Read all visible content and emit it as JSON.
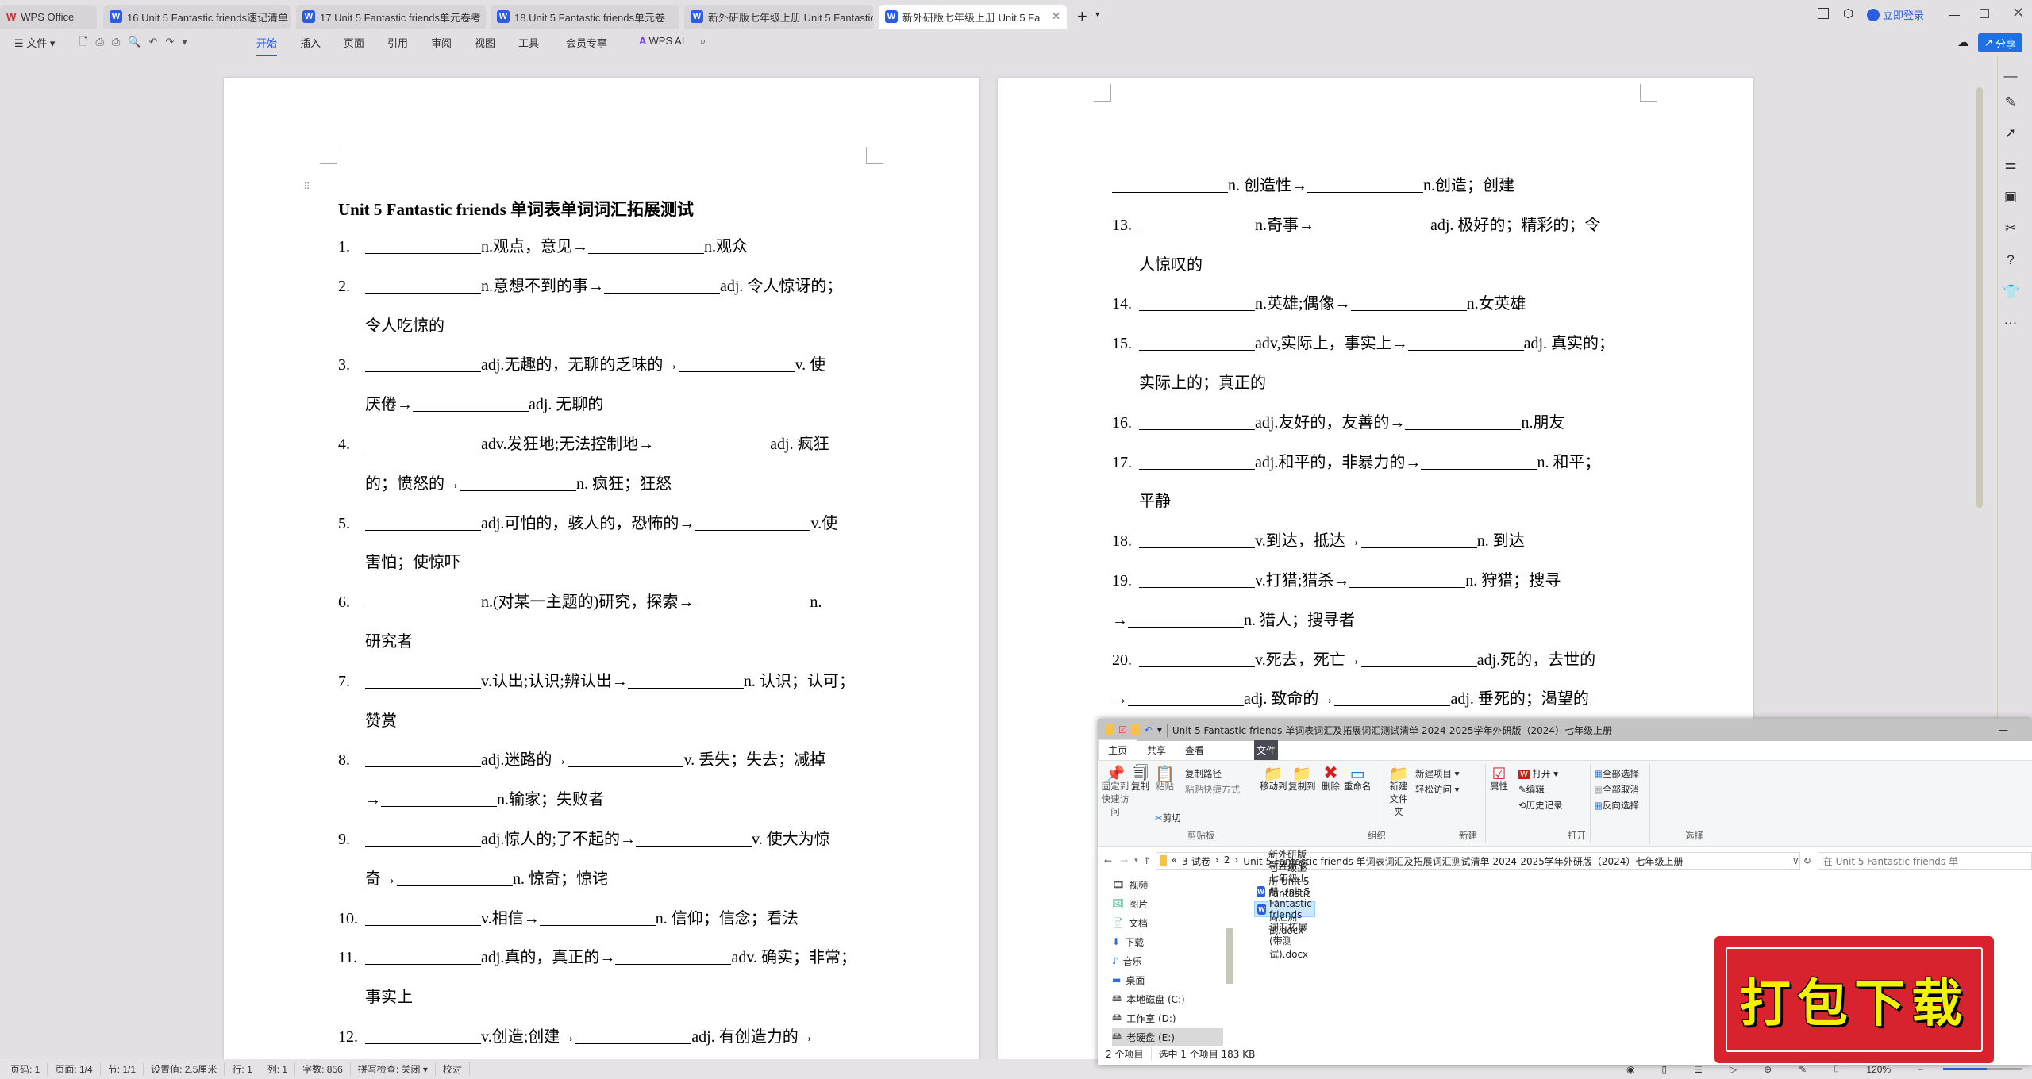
{
  "tabs": [
    {
      "label": "WPS Office",
      "icon": "wps-logo-icon"
    },
    {
      "label": "16.Unit 5 Fantastic friends速记清单"
    },
    {
      "label": "17.Unit 5 Fantastic friends单元卷考"
    },
    {
      "label": "18.Unit 5 Fantastic friends单元卷"
    },
    {
      "label": "新外研版七年级上册 Unit 5 Fantastic"
    },
    {
      "label": "新外研版七年级上册 Unit 5 Fa",
      "active": true
    }
  ],
  "titlebar": {
    "login": "立即登录",
    "share": "分享"
  },
  "toolbar": {
    "file": "文件",
    "menus": [
      "开始",
      "插入",
      "页面",
      "引用",
      "审阅",
      "视图",
      "工具",
      "会员专享"
    ],
    "active": "开始",
    "ai": "WPS AI"
  },
  "page1": {
    "title": "Unit 5 Fantastic friends  单词表单词词汇拓展测试",
    "lines": [
      {
        "num": "1.",
        "segs": [
          "",
          "n.观点，意见→",
          "",
          "n.观众"
        ]
      },
      {
        "num": "2.",
        "segs": [
          "",
          "n.意想不到的事→",
          "",
          "adj. 令人惊讶的；"
        ]
      },
      {
        "indent": true,
        "segs": [
          "令人吃惊的"
        ]
      },
      {
        "num": "3.",
        "segs": [
          "",
          "adj.无趣的，无聊的乏味的→",
          "",
          "v. 使"
        ]
      },
      {
        "indent": true,
        "segs": [
          "厌倦→",
          "",
          "adj. 无聊的"
        ]
      },
      {
        "num": "4.",
        "segs": [
          "",
          "adv.发狂地;无法控制地→",
          "",
          "adj. 疯狂"
        ]
      },
      {
        "indent": true,
        "segs": [
          "的；愤怒的→",
          "",
          "n. 疯狂；狂怒"
        ]
      },
      {
        "num": "5.",
        "segs": [
          "",
          "adj.可怕的，骇人的，恐怖的→",
          "",
          "v.使"
        ]
      },
      {
        "indent": true,
        "segs": [
          "害怕；使惊吓"
        ]
      },
      {
        "num": "6.",
        "segs": [
          "",
          "n.(对某一主题的)研究，探索→",
          "",
          "n."
        ]
      },
      {
        "indent": true,
        "segs": [
          "研究者"
        ]
      },
      {
        "num": "7.",
        "segs": [
          "",
          "v.认出;认识;辨认出→",
          "",
          "n. 认识；认可；"
        ]
      },
      {
        "indent": true,
        "segs": [
          "赞赏"
        ]
      },
      {
        "num": "8.",
        "segs": [
          "",
          "adj.迷路的→",
          "",
          "v. 丢失；失去；减掉"
        ]
      },
      {
        "indent": true,
        "segs": [
          "→",
          "",
          "n.输家；失败者"
        ]
      },
      {
        "num": "9.",
        "segs": [
          "",
          "adj.惊人的;了不起的→",
          "",
          "v. 使大为惊"
        ]
      },
      {
        "indent": true,
        "segs": [
          "奇→",
          "",
          "n. 惊奇；惊诧"
        ]
      },
      {
        "num": "10.",
        "segs": [
          "",
          "v.相信→",
          "",
          "n. 信仰；信念；看法"
        ]
      },
      {
        "num": "11.",
        "segs": [
          "",
          "adj.真的，真正的→",
          "",
          "adv. 确实；非常；"
        ]
      },
      {
        "indent": true,
        "segs": [
          "事实上"
        ]
      },
      {
        "num": "12.",
        "segs": [
          "",
          "v.创造;创建→",
          "",
          "adj. 有创造力的→"
        ]
      }
    ]
  },
  "page2": {
    "lines": [
      {
        "segs": [
          "",
          "n. 创造性→",
          "",
          "n.创造；创建"
        ]
      },
      {
        "num": "13.",
        "segs": [
          "",
          "n.奇事→",
          "",
          "adj. 极好的；精彩的；令"
        ]
      },
      {
        "indent": true,
        "segs": [
          "人惊叹的"
        ]
      },
      {
        "num": "14.",
        "segs": [
          "",
          "n.英雄;偶像→",
          "",
          "n.女英雄"
        ]
      },
      {
        "num": "15.",
        "segs": [
          "",
          "adv,实际上，事实上→",
          "",
          "adj. 真实的；"
        ]
      },
      {
        "indent": true,
        "segs": [
          "实际上的；真正的"
        ]
      },
      {
        "num": "16.",
        "segs": [
          "",
          "adj.友好的，友善的→",
          "",
          "n.朋友"
        ]
      },
      {
        "num": "17.",
        "segs": [
          "",
          "adj.和平的，非暴力的→",
          "",
          "n. 和平；"
        ]
      },
      {
        "indent": true,
        "segs": [
          "平静"
        ]
      },
      {
        "num": "18.",
        "segs": [
          "",
          "v.到达，抵达→",
          "",
          "n. 到达"
        ]
      },
      {
        "num": "19.",
        "segs": [
          "",
          "v.打猎;猎杀→",
          "",
          "n. 狩猎；搜寻"
        ]
      },
      {
        "segs": [
          "→",
          "",
          "n. 猎人；搜寻者"
        ]
      },
      {
        "num": "20.",
        "segs": [
          "",
          "v.死去，死亡→",
          "",
          "adj.死的，去世的"
        ]
      },
      {
        "segs": [
          "→",
          "",
          "adj. 致命的→",
          "",
          "adj. 垂死的；渴望的"
        ]
      }
    ]
  },
  "statusbar": {
    "items": [
      "页码: 1",
      "页面: 1/4",
      "节: 1/1",
      "设置值: 2.5厘米",
      "行: 1",
      "列: 1",
      "字数: 856",
      "拼写检查: 关闭 ▾",
      "校对"
    ],
    "zoom": "120%",
    "zoom_level": 0.55
  },
  "explorer": {
    "title": "Unit 5 Fantastic friends 单词表词汇及拓展词汇测试清单 2024-2025学年外研版（2024）七年级上册",
    "ribbon_tabs": [
      "文件",
      "主页",
      "共享",
      "查看"
    ],
    "clipboard": {
      "pin": "固定到快速访问",
      "copy": "复制",
      "paste": "粘贴",
      "copy_path": "复制路径",
      "paste_shortcut": "粘贴快捷方式",
      "cut": "剪切",
      "label": "剪贴板"
    },
    "organize": {
      "move": "移动到",
      "copyto": "复制到",
      "delete": "删除",
      "rename": "重命名",
      "label": "组织"
    },
    "new": {
      "folder": "新建文件夹",
      "item": "新建项目 ▾",
      "easy": "轻松访问 ▾",
      "label": "新建"
    },
    "open": {
      "props": "属性",
      "open": "打开 ▾",
      "edit": "编辑",
      "history": "历史记录",
      "label": "打开"
    },
    "select": {
      "all": "全部选择",
      "none": "全部取消",
      "invert": "反向选择",
      "label": "选择"
    },
    "breadcrumb": [
      "«",
      "3-试卷",
      "›",
      "2",
      "›",
      "Unit 5 Fantastic friends 单词表词汇及拓展词汇测试清单 2024-2025学年外研版（2024）七年级上册"
    ],
    "search_placeholder": "在 Unit 5 Fantastic friends 单",
    "nav": [
      "视频",
      "图片",
      "文档",
      "下载",
      "音乐",
      "桌面",
      "本地磁盘 (C:)",
      "工作室 (D:)",
      "老硬盘 (E:)"
    ],
    "files": [
      "新外研版七年级上册 Unit 5 Fantastic friends 词汇测试.docx",
      "新外研版七年级上册 Unit 5 Fantastic friends 词汇拓展(带测试).docx"
    ],
    "status": {
      "count": "2 个项目",
      "selected": "选中 1 个项目  183 KB"
    }
  },
  "stamp": {
    "text": "打包下载",
    "bg": "#d8232f",
    "fg": "#f2f200"
  }
}
